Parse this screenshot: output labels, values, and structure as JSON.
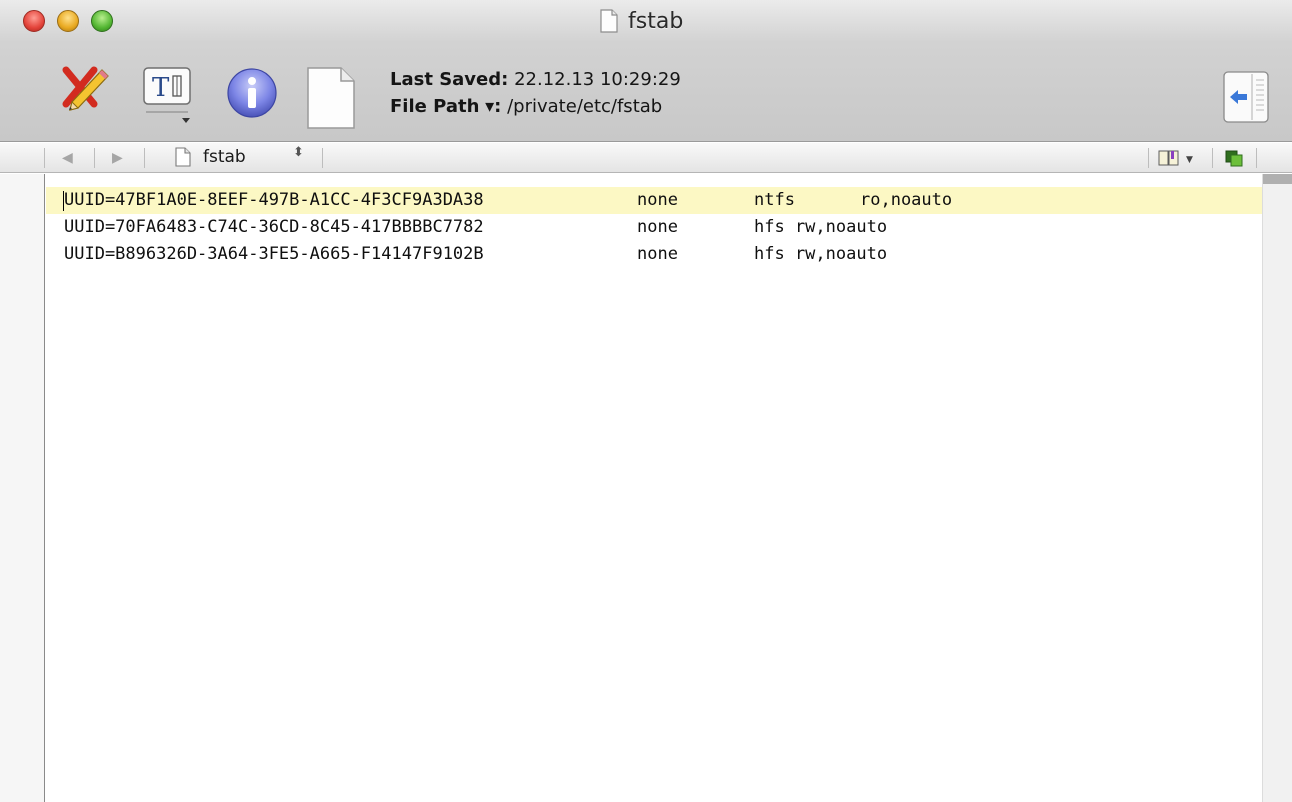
{
  "window": {
    "title": "fstab"
  },
  "toolbar": {
    "tools": [
      {
        "name": "edit",
        "icon": "pencil-icon"
      },
      {
        "name": "text-style",
        "icon": "text-style-icon"
      },
      {
        "name": "info",
        "icon": "info-icon"
      },
      {
        "name": "document",
        "icon": "document-icon"
      }
    ],
    "last_saved_label": "Last Saved:",
    "last_saved_value": "22.12.13 10:29:29",
    "file_path_label": "File Path",
    "file_path_arrow": "▾",
    "file_path_colon": ":",
    "file_path_value": "/private/etc/fstab",
    "drawer_icon": "drawer-toggle-icon"
  },
  "navbar": {
    "back_symbol": "◀",
    "forward_symbol": "▶",
    "file_name": "fstab",
    "stepper_symbol": "⬍",
    "bookmark_icon": "bookmark-icon",
    "counterpart_icon": "counterpart-icon"
  },
  "editor": {
    "current_line_color": "#fcf8c4",
    "lines": [
      {
        "uuid": "UUID=47BF1A0E-8EEF-497B-A1CC-4F3CF9A3DA38",
        "mount": "none",
        "type": "ntfs",
        "options": "ro,noauto"
      },
      {
        "uuid": "UUID=70FA6483-C74C-36CD-8C45-417BBBBC7782",
        "mount": "none",
        "type_options": "hfs rw,noauto"
      },
      {
        "uuid": "UUID=B896326D-3A64-3FE5-A665-F14147F9102B",
        "mount": "none",
        "type_options": "hfs rw,noauto"
      }
    ]
  }
}
